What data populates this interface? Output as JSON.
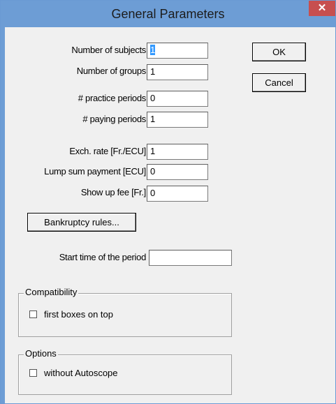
{
  "window": {
    "title": "General Parameters",
    "close_glyph": "✕"
  },
  "fields": {
    "num_subjects": {
      "label": "Number of subjects",
      "value": "1"
    },
    "num_groups": {
      "label": "Number of groups",
      "value": "1"
    },
    "practice": {
      "label": "# practice periods",
      "value": "0"
    },
    "paying": {
      "label": "# paying periods",
      "value": "1"
    },
    "exch_rate": {
      "label": "Exch. rate [Fr./ECU]",
      "value": "1"
    },
    "lump_sum": {
      "label": "Lump sum payment [ECU]",
      "value": "0"
    },
    "show_up": {
      "label": "Show up fee [Fr.]",
      "value": "0"
    },
    "start_time": {
      "label": "Start time of the period",
      "value": ""
    }
  },
  "buttons": {
    "ok": "OK",
    "cancel": "Cancel",
    "bankruptcy": "Bankruptcy rules..."
  },
  "compatibility": {
    "title": "Compatibility",
    "checkbox_label": "first boxes on top",
    "checked": false
  },
  "options": {
    "title": "Options",
    "checkbox_label": "without Autoscope",
    "checked": false
  }
}
